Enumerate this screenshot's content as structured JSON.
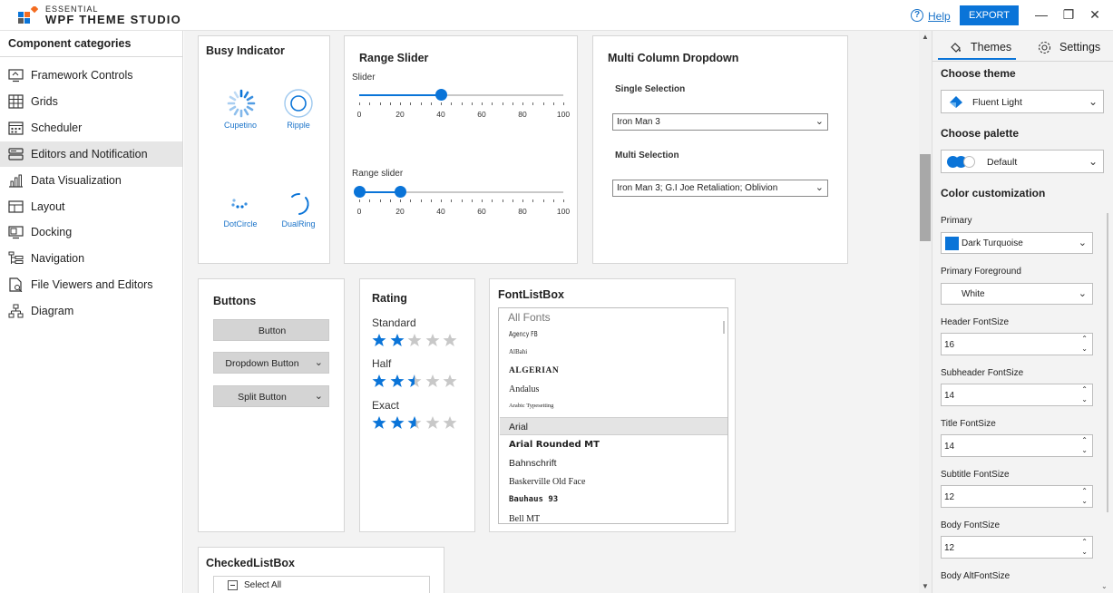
{
  "app": {
    "brand_small": "ESSENTIAL",
    "brand_title": "WPF THEME STUDIO",
    "help": "Help",
    "export": "EXPORT"
  },
  "sidebar": {
    "title": "Component categories",
    "items": [
      {
        "label": "Framework Controls",
        "icon": "monitor-icon"
      },
      {
        "label": "Grids",
        "icon": "grid-icon"
      },
      {
        "label": "Scheduler",
        "icon": "calendar-icon"
      },
      {
        "label": "Editors and Notification",
        "icon": "editor-icon",
        "selected": true
      },
      {
        "label": "Data Visualization",
        "icon": "chart-icon"
      },
      {
        "label": "Layout",
        "icon": "layout-icon"
      },
      {
        "label": "Docking",
        "icon": "docking-icon"
      },
      {
        "label": "Navigation",
        "icon": "navigation-icon"
      },
      {
        "label": "File Viewers and Editors",
        "icon": "file-icon"
      },
      {
        "label": "Diagram",
        "icon": "diagram-icon"
      }
    ]
  },
  "busy": {
    "title": "Busy Indicator",
    "items": [
      "Cupetino",
      "Ripple",
      "DotCircle",
      "DualRing"
    ]
  },
  "range": {
    "title": "Range Slider",
    "slider_label": "Slider",
    "range_label": "Range slider",
    "ticks": [
      "0",
      "20",
      "40",
      "60",
      "80",
      "100"
    ],
    "slider_value": 40,
    "range_values": [
      0,
      20
    ]
  },
  "mcd": {
    "title": "Multi Column Dropdown",
    "single_label": "Single Selection",
    "single_value": "Iron Man 3",
    "multi_label": "Multi Selection",
    "multi_value": "Iron Man 3; G.I Joe Retaliation; Oblivion"
  },
  "buttons": {
    "title": "Buttons",
    "button": "Button",
    "dropdown": "Dropdown Button",
    "split": "Split Button"
  },
  "rating": {
    "title": "Rating",
    "rows": [
      {
        "label": "Standard",
        "value": 2
      },
      {
        "label": "Half",
        "value": 2.5
      },
      {
        "label": "Exact",
        "value": 2.6
      }
    ],
    "max": 5
  },
  "fontlist": {
    "title": "FontListBox",
    "header": "All Fonts",
    "items": [
      "Agency FB",
      "AlBahi",
      "ALGERIAN",
      "Andalus",
      "Arabic Typesetting",
      "Arial",
      "Arial Rounded MT",
      "Bahnschrift",
      "Baskerville Old Face",
      "Bauhaus 93",
      "Bell MT"
    ],
    "selected": "Arial"
  },
  "checked": {
    "title": "CheckedListBox",
    "select_all": "Select All"
  },
  "panel": {
    "tabs": [
      "Themes",
      "Settings"
    ],
    "choose_theme": "Choose theme",
    "theme": "Fluent Light",
    "choose_palette": "Choose palette",
    "palette": "Default",
    "color_custom": "Color customization",
    "primary_label": "Primary",
    "primary_value": "Dark Turquoise",
    "primary_color": "#0a74d8",
    "primary_fg_label": "Primary Foreground",
    "primary_fg_value": "White",
    "fields": [
      {
        "label": "Header FontSize",
        "value": "16"
      },
      {
        "label": "Subheader FontSize",
        "value": "14"
      },
      {
        "label": "Title FontSize",
        "value": "14"
      },
      {
        "label": "Subtitle FontSize",
        "value": "12"
      },
      {
        "label": "Body FontSize",
        "value": "12"
      }
    ],
    "last_label": "Body AltFontSize"
  },
  "colors": {
    "accent": "#0a74d8",
    "star_empty": "#c8c8c8"
  }
}
